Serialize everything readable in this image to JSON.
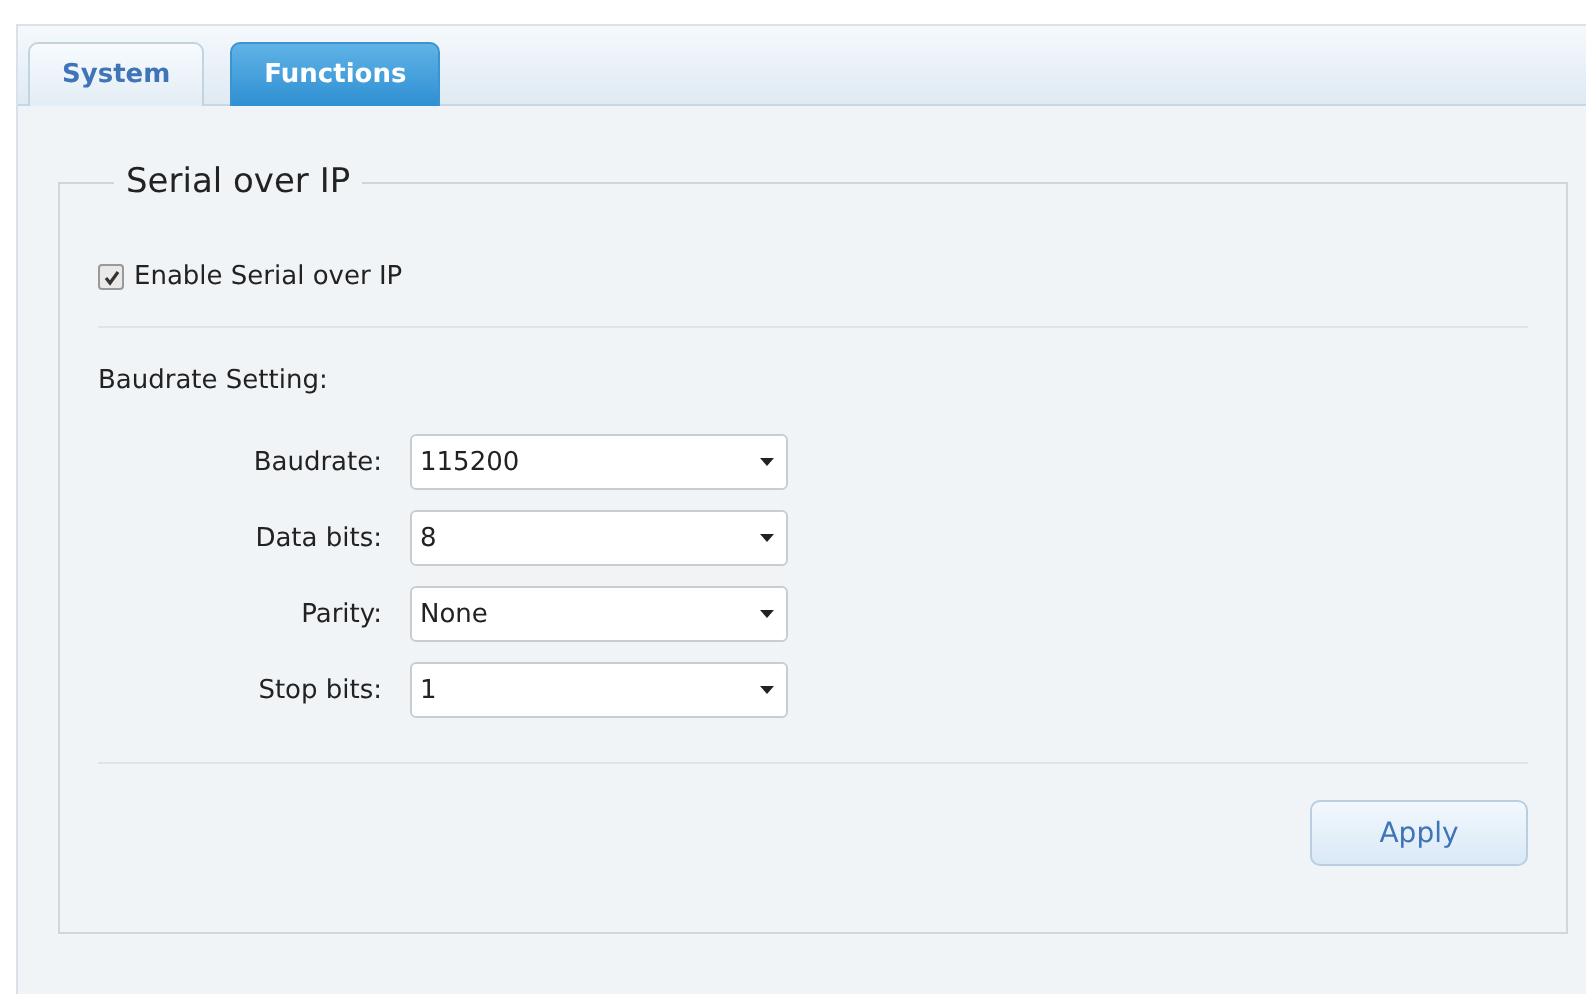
{
  "tabs": [
    {
      "label": "System",
      "selected": false
    },
    {
      "label": "Functions",
      "selected": true
    }
  ],
  "section": {
    "title": "Serial over IP",
    "enable": {
      "label": "Enable Serial over IP",
      "checked": true
    },
    "subtitle": "Baudrate Setting:",
    "fields": [
      {
        "label": "Baudrate:",
        "value": "115200"
      },
      {
        "label": "Data bits:",
        "value": "8"
      },
      {
        "label": "Parity:",
        "value": "None"
      },
      {
        "label": "Stop bits:",
        "value": "1"
      }
    ]
  },
  "buttons": [
    {
      "label": "Apply"
    }
  ]
}
